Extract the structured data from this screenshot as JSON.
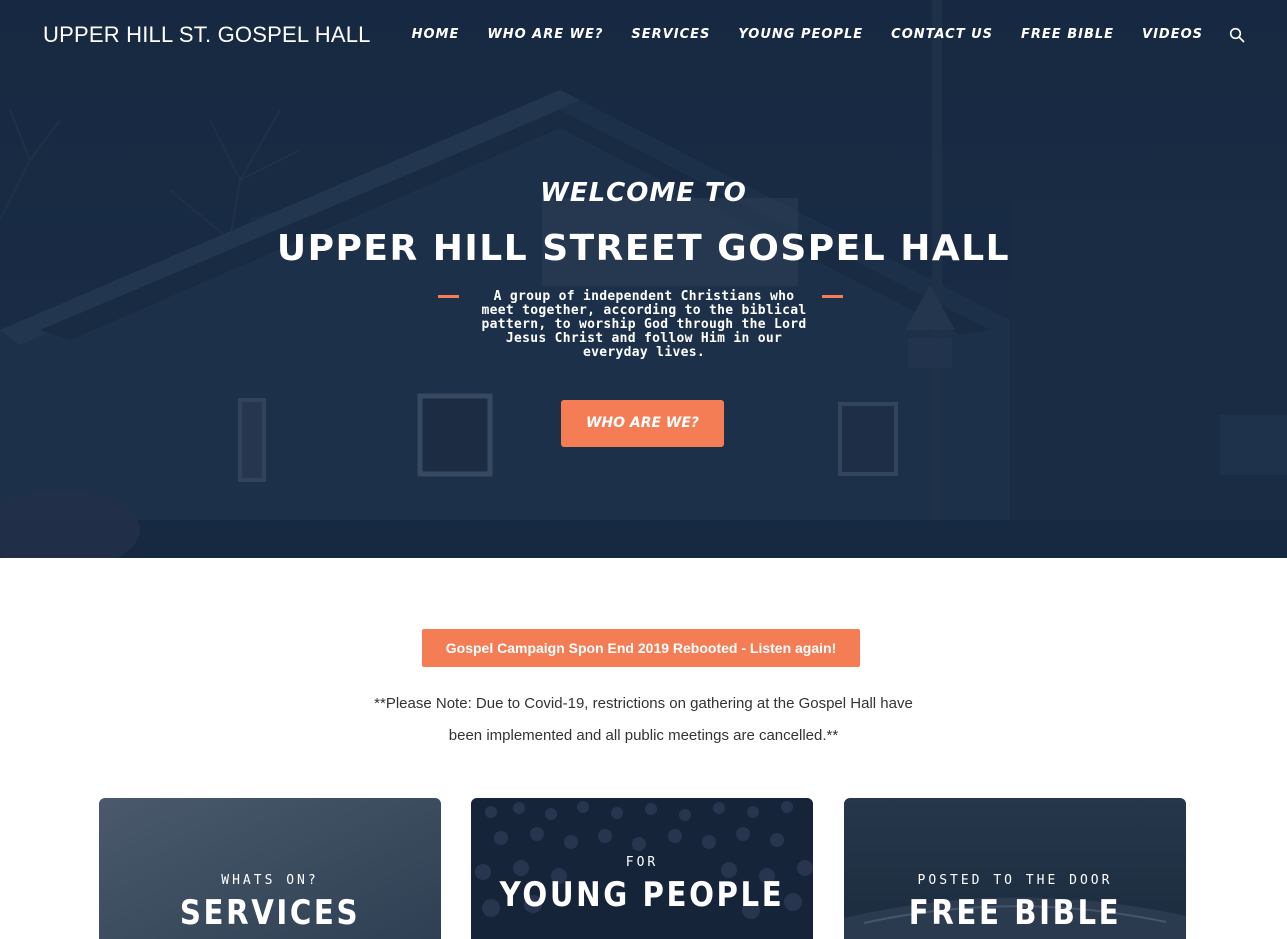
{
  "header": {
    "brand": "UPPER HILL ST. GOSPEL HALL",
    "nav": [
      "HOME",
      "WHO ARE WE?",
      "SERVICES",
      "YOUNG PEOPLE",
      "CONTACT US",
      "FREE BIBLE",
      "VIDEOS"
    ],
    "search_icon": "search-icon"
  },
  "hero": {
    "welcome": "WELCOME TO",
    "title": "UPPER HILL STREET GOSPEL HALL",
    "description": "A group of independent Christians who meet together, according to the biblical pattern, to worship God through the Lord Jesus Christ and follow Him in our everyday lives.",
    "button": "WHO ARE WE?"
  },
  "notice": {
    "campaign_button": "Gospel Campaign Spon End 2019 Rebooted - Listen again!",
    "covid_note": "**Please Note: Due to Covid-19, restrictions on gathering at the Gospel Hall have been implemented and all public meetings are cancelled.**"
  },
  "cards": [
    {
      "kicker": "WHATS ON?",
      "title": "SERVICES"
    },
    {
      "kicker": "FOR",
      "title": "YOUNG PEOPLE"
    },
    {
      "kicker": "POSTED TO THE DOOR",
      "title": "FREE BIBLE"
    }
  ],
  "colors": {
    "accent": "#f47d55",
    "hero_overlay": "#1b2e48",
    "text_dark": "#333333"
  }
}
